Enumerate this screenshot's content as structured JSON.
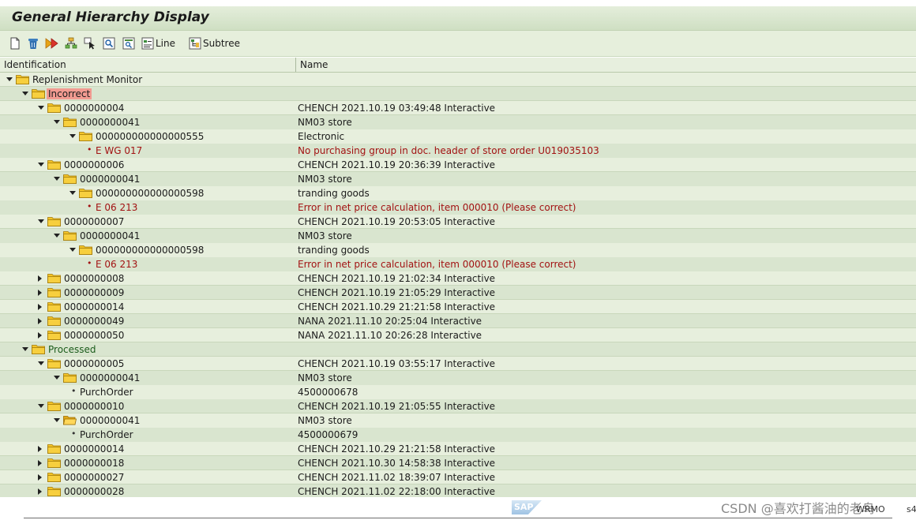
{
  "title": "General Hierarchy Display",
  "toolbar": {
    "line_label": "Line",
    "subtree_label": "Subtree"
  },
  "columns": {
    "identification": "Identification",
    "name": "Name"
  },
  "colors": {
    "highlight": "#f29b91",
    "error_text": "#a21212",
    "folder": "#f4c427",
    "row_alt": "#e7efdd",
    "row_base": "#d9e5cf"
  },
  "rows": [
    {
      "level": 0,
      "toggle": "down",
      "icon": "folder-icon",
      "id": "Replenishment Monitor",
      "name": ""
    },
    {
      "level": 1,
      "toggle": "down",
      "icon": "folder-icon",
      "id": "Incorrect",
      "name": "",
      "style": "hl"
    },
    {
      "level": 2,
      "toggle": "down",
      "icon": "folder-icon",
      "id": "0000000004",
      "name": "CHENCH 2021.10.19 03:49:48 Interactive"
    },
    {
      "level": 3,
      "toggle": "down",
      "icon": "folder-icon",
      "id": "0000000041",
      "name": "NM03 store"
    },
    {
      "level": 4,
      "toggle": "down",
      "icon": "folder-icon",
      "id": "000000000000000555",
      "name": "Electronic"
    },
    {
      "level": 5,
      "toggle": "none",
      "icon": "bullet",
      "id": "E WG 017",
      "name": "No purchasing group in doc. header of store order U019035103",
      "style": "red"
    },
    {
      "level": 2,
      "toggle": "down",
      "icon": "folder-icon",
      "id": "0000000006",
      "name": "CHENCH 2021.10.19 20:36:39 Interactive"
    },
    {
      "level": 3,
      "toggle": "down",
      "icon": "folder-icon",
      "id": "0000000041",
      "name": "NM03 store"
    },
    {
      "level": 4,
      "toggle": "down",
      "icon": "folder-icon",
      "id": "000000000000000598",
      "name": "tranding goods"
    },
    {
      "level": 5,
      "toggle": "none",
      "icon": "bullet",
      "id": "E 06 213",
      "name": "Error in net price calculation, item 000010 (Please correct)",
      "style": "red"
    },
    {
      "level": 2,
      "toggle": "down",
      "icon": "folder-icon",
      "id": "0000000007",
      "name": "CHENCH 2021.10.19 20:53:05 Interactive"
    },
    {
      "level": 3,
      "toggle": "down",
      "icon": "folder-icon",
      "id": "0000000041",
      "name": "NM03 store"
    },
    {
      "level": 4,
      "toggle": "down",
      "icon": "folder-icon",
      "id": "000000000000000598",
      "name": "tranding goods"
    },
    {
      "level": 5,
      "toggle": "none",
      "icon": "bullet",
      "id": "E 06 213",
      "name": "Error in net price calculation, item 000010 (Please correct)",
      "style": "red"
    },
    {
      "level": 2,
      "toggle": "right",
      "icon": "folder-icon",
      "id": "0000000008",
      "name": "CHENCH 2021.10.19 21:02:34 Interactive"
    },
    {
      "level": 2,
      "toggle": "right",
      "icon": "folder-icon",
      "id": "0000000009",
      "name": "CHENCH 2021.10.19 21:05:29 Interactive"
    },
    {
      "level": 2,
      "toggle": "right",
      "icon": "folder-icon",
      "id": "0000000014",
      "name": "CHENCH 2021.10.29 21:21:58 Interactive"
    },
    {
      "level": 2,
      "toggle": "right",
      "icon": "folder-icon",
      "id": "0000000049",
      "name": "NANA 2021.11.10 20:25:04 Interactive"
    },
    {
      "level": 2,
      "toggle": "right",
      "icon": "folder-icon",
      "id": "0000000050",
      "name": "NANA 2021.11.10 20:26:28 Interactive"
    },
    {
      "level": 1,
      "toggle": "down",
      "icon": "folder-icon",
      "id": "Processed",
      "name": "",
      "style": "proc"
    },
    {
      "level": 2,
      "toggle": "down",
      "icon": "folder-icon",
      "id": "0000000005",
      "name": "CHENCH 2021.10.19 03:55:17 Interactive"
    },
    {
      "level": 3,
      "toggle": "down",
      "icon": "folder-icon",
      "id": "0000000041",
      "name": "NM03 store"
    },
    {
      "level": 4,
      "toggle": "none",
      "icon": "bullet",
      "id": "PurchOrder",
      "name": "4500000678"
    },
    {
      "level": 2,
      "toggle": "down",
      "icon": "folder-icon",
      "id": "0000000010",
      "name": "CHENCH 2021.10.19 21:05:55 Interactive"
    },
    {
      "level": 3,
      "toggle": "down",
      "icon": "folder-open-icon",
      "id": "0000000041",
      "name": "NM03 store"
    },
    {
      "level": 4,
      "toggle": "none",
      "icon": "bullet",
      "id": "PurchOrder",
      "name": "4500000679"
    },
    {
      "level": 2,
      "toggle": "right",
      "icon": "folder-icon",
      "id": "0000000014",
      "name": "CHENCH 2021.10.29 21:21:58 Interactive"
    },
    {
      "level": 2,
      "toggle": "right",
      "icon": "folder-icon",
      "id": "0000000018",
      "name": "CHENCH 2021.10.30 14:58:38 Interactive"
    },
    {
      "level": 2,
      "toggle": "right",
      "icon": "folder-icon",
      "id": "0000000027",
      "name": "CHENCH 2021.11.02 18:39:07 Interactive"
    },
    {
      "level": 2,
      "toggle": "right",
      "icon": "folder-icon",
      "id": "0000000028",
      "name": "CHENCH 2021.11.02 22:18:00 Interactive"
    },
    {
      "level": 2,
      "toggle": "right",
      "icon": "folder-icon",
      "id": "",
      "name": ""
    }
  ],
  "status": {
    "sap_logo": "SAP",
    "system": "WRMO",
    "client": "s4"
  },
  "watermark": "CSDN @喜欢打酱油的老鸟"
}
